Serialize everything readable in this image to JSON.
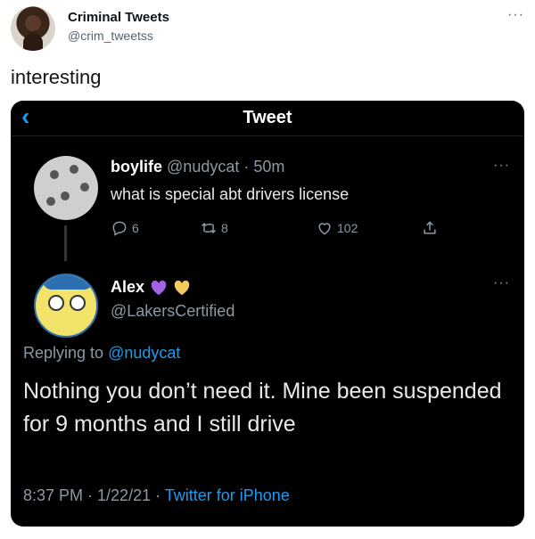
{
  "outer": {
    "display_name": "Criminal Tweets",
    "handle": "@crim_tweetss",
    "text": "interesting",
    "more": "···"
  },
  "embedded": {
    "header_title": "Tweet",
    "back_icon": "‹",
    "tweet1": {
      "name": "boylife",
      "handle": "@nudycat",
      "sep": " · ",
      "time": "50m",
      "text": "what is special abt drivers license",
      "more": "···",
      "reply_count": "6",
      "retweet_count": "8",
      "like_count": "102"
    },
    "tweet2": {
      "name": "Alex",
      "handle": "@LakersCertified",
      "more": "···",
      "replying_prefix": "Replying to ",
      "replying_mention": "@nudycat",
      "text": "Nothing you don’t need it. Mine been suspended for 9 months and I still drive",
      "footer_time": "8:37 PM · 1/22/21 · ",
      "footer_source": "Twitter for iPhone",
      "heart_colors": [
        "#a063e8",
        "#f4c95d"
      ]
    },
    "colors": {
      "accent": "#1d9bf0",
      "muted": "#8b98a5",
      "background": "#000000"
    }
  }
}
